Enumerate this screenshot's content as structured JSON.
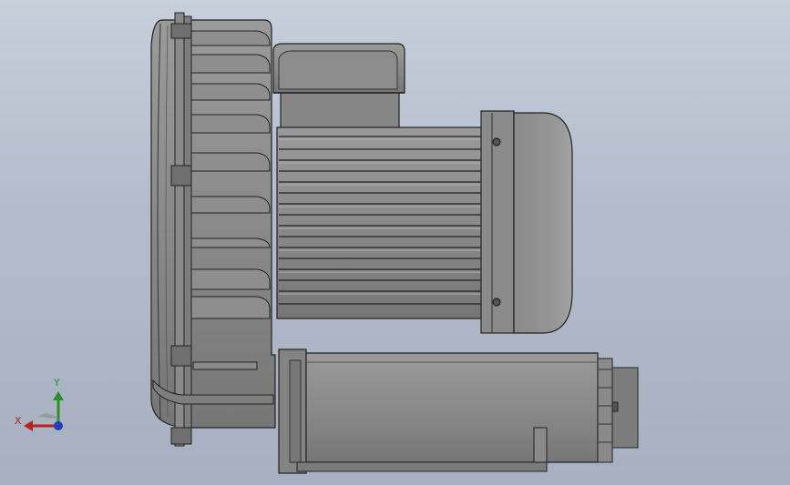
{
  "viewport": {
    "background_top": "#c7cfdb",
    "background_bottom": "#a6b0c0"
  },
  "model": {
    "name": "side-channel-blower",
    "body_color": "#8c8c8c",
    "edge_color": "#222222"
  },
  "triad": {
    "x_label": "X",
    "y_label": "Y",
    "x_color": "#b3261e",
    "y_color": "#2f8f2f",
    "z_color": "#1f3fbf"
  }
}
